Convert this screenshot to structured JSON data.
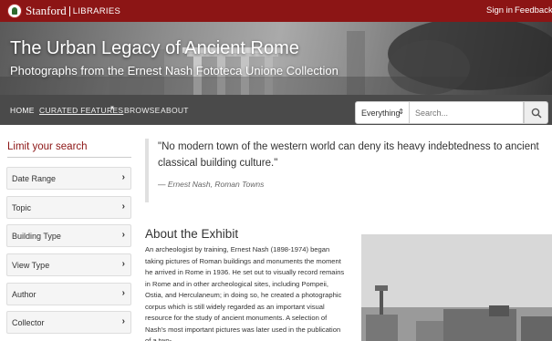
{
  "brand": {
    "name": "Stanford",
    "libraries": "LIBRARIES"
  },
  "utility": {
    "signin": "Sign in",
    "feedback": "Feedback"
  },
  "hero": {
    "title": "The Urban Legacy of Ancient Rome",
    "subtitle": "Photographs from the Ernest Nash Fototeca Unione Collection"
  },
  "nav": {
    "items": [
      {
        "label": "HOME"
      },
      {
        "label": "CURATED FEATURES"
      },
      {
        "label": "BROWSE"
      },
      {
        "label": "ABOUT"
      }
    ]
  },
  "search": {
    "scope": "Everything",
    "placeholder": "Search..."
  },
  "sidebar": {
    "title": "Limit your search",
    "facets": [
      {
        "label": "Date Range"
      },
      {
        "label": "Topic"
      },
      {
        "label": "Building Type"
      },
      {
        "label": "View Type"
      },
      {
        "label": "Author"
      },
      {
        "label": "Collector"
      }
    ]
  },
  "quote": {
    "text": "\"No modern town of the western world can deny its heavy indebtedness to ancient classical building culture.\"",
    "cite": "— Ernest Nash, Roman Towns"
  },
  "about": {
    "title": "About the Exhibit",
    "body": "An archeologist by training, Ernest Nash (1898-1974) began taking pictures of Roman buildings and monuments the moment he arrived in Rome in 1936. He set out to visually record remains in Rome and in other archeological sites, including Pompeii, Ostia, and Herculaneum; in doing so, he created a photographic corpus which is still widely regarded as an important visual resource for the study of ancient monuments. A selection of Nash's most important pictures was later used in the publication of a two-"
  },
  "colors": {
    "brand": "#8c1515",
    "nav_bg": "#4a4a4a"
  },
  "icons": {
    "search": "magnifier-icon",
    "seal": "stanford-seal-icon",
    "chevron": "chevron-right-icon"
  }
}
